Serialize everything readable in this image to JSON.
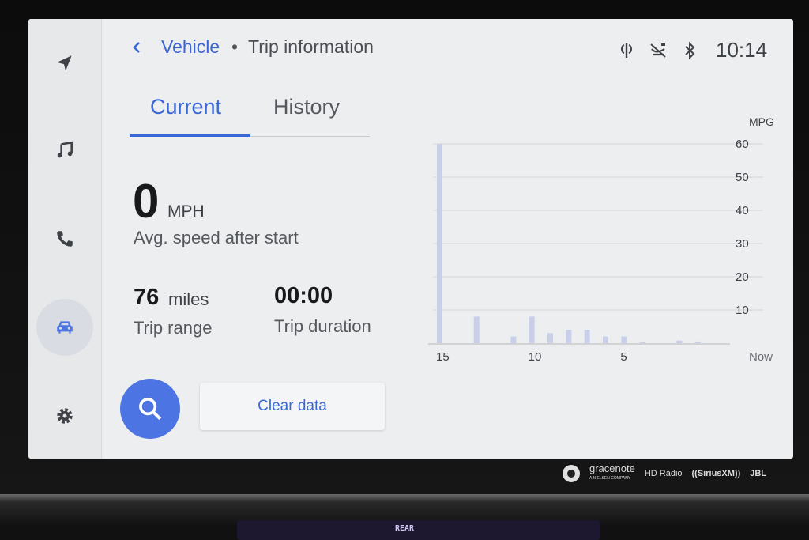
{
  "header": {
    "breadcrumb_parent": "Vehicle",
    "separator": "•",
    "breadcrumb_current": "Trip information",
    "clock": "10:14",
    "status_icons": [
      "wireless-charging-icon",
      "seatbelt-off-icon",
      "bluetooth-icon"
    ]
  },
  "sidebar": {
    "items": [
      {
        "icon": "navigation-icon"
      },
      {
        "icon": "music-icon"
      },
      {
        "icon": "phone-icon"
      },
      {
        "icon": "car-icon",
        "active": true
      },
      {
        "icon": "gear-icon"
      }
    ]
  },
  "tabs": [
    {
      "label": "Current",
      "active": true
    },
    {
      "label": "History",
      "active": false
    }
  ],
  "stats": {
    "speed_value": "0",
    "speed_unit": "MPH",
    "speed_label": "Avg. speed after start",
    "range_value": "76",
    "range_unit": "miles",
    "range_label": "Trip range",
    "duration_value": "00:00",
    "duration_label": "Trip duration"
  },
  "actions": {
    "clear_label": "Clear data"
  },
  "chart_data": {
    "type": "bar",
    "ylabel": "MPG",
    "ylim": [
      0,
      60
    ],
    "yticks": [
      10,
      20,
      30,
      40,
      50,
      60
    ],
    "x_tick_labels": [
      {
        "pos": 15,
        "label": "15"
      },
      {
        "pos": 10,
        "label": "10"
      },
      {
        "pos": 5,
        "label": "5"
      },
      {
        "pos": 0,
        "label": "Now"
      }
    ],
    "xlim": [
      15,
      0
    ],
    "x": [
      15,
      13,
      11,
      10,
      9,
      8,
      7,
      6,
      5,
      4,
      2,
      1
    ],
    "values": [
      60,
      8,
      2,
      8,
      3,
      4,
      4,
      2,
      2,
      0.3,
      0.8,
      0.5
    ],
    "grid": true,
    "colors": {
      "bar": "#c9cfe9",
      "grid": "#d3d5d8",
      "axis": "#c6c8cb"
    }
  },
  "brands": {
    "gracenote": "gracenote",
    "gracenote_sub": "A NIELSEN COMPANY",
    "hd_radio": "HD Radio",
    "siriusxm": "((SiriusXM))",
    "jbl": "JBL"
  },
  "console": {
    "rear_label": "REAR"
  },
  "colors": {
    "accent": "#3a67d8",
    "screen_bg": "#eceef0",
    "search_button": "#4c74e2"
  }
}
